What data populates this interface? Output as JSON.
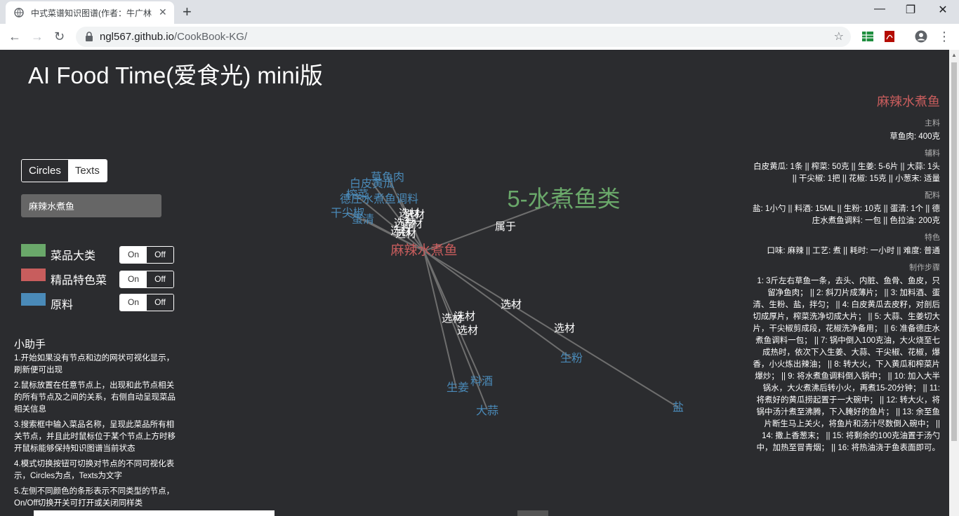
{
  "browser": {
    "tab_title": "中式菜谱知识图谱(作者：牛广林",
    "tab_close": "✕",
    "new_tab": "+",
    "url_host": "ngl567.github.io",
    "url_path": "/CookBook-KG/",
    "window_minimize": "—",
    "window_restore": "❐",
    "window_close": "✕"
  },
  "app": {
    "title": "AI Food Time(爱食光) mini版",
    "modes": {
      "circles": "Circles",
      "texts": "Texts",
      "active": "Circles"
    },
    "search_value": "麻辣水煮鱼",
    "legend": [
      {
        "label": "菜品大类",
        "color": "#6aa86a",
        "on": "On",
        "off": "Off"
      },
      {
        "label": "精品特色菜",
        "color": "#c85d5d",
        "on": "On",
        "off": "Off"
      },
      {
        "label": "原料",
        "color": "#4a8ab8",
        "on": "On",
        "off": "Off"
      }
    ],
    "helper": {
      "title": "小助手",
      "tips": [
        "1.开始如果没有节点和边的网状可视化显示，刷新便可出现",
        "2.鼠标放置在任意节点上，出现和此节点相关的所有节点及之间的关系，右侧自动呈现菜品相关信息",
        "3.搜索框中输入菜品名称，呈现此菜品所有相关节点，并且此时鼠标位于某个节点上方时移开鼠标能够保持知识图谱当前状态",
        "4.模式切换按钮可切换对节点的不同可视化表示，Circles为点，Texts为文字",
        "5.左侧不同颜色的条形表示不同类型的节点，On/Off切换开关可打开或关闭同样类"
      ]
    }
  },
  "graph": {
    "center": {
      "label": "麻辣水煮鱼"
    },
    "category": {
      "label": "5-水煮鱼类",
      "relation": "属于"
    },
    "ingredients": [
      "草鱼肉",
      "白皮黄瓜",
      "榨菜",
      "德庄水煮鱼调料",
      "干尖椒",
      "蛋清",
      "生姜",
      "料酒",
      "大蒜",
      "生粉",
      "盐"
    ],
    "relation_label": "选材"
  },
  "panel": {
    "name": "麻辣水煮鱼",
    "sections": [
      {
        "heading": "主料",
        "text": "草鱼肉: 400克"
      },
      {
        "heading": "辅料",
        "text": "白皮黄瓜: 1条 || 榨菜: 50克 || 生姜: 5-6片 || 大蒜: 1头 || 干尖椒: 1把 || 花椒: 15克 || 小葱末: 适量"
      },
      {
        "heading": "配料",
        "text": "盐: 1小勺 || 料酒: 15ML || 生粉: 10克 || 蛋清: 1个 || 德庄水煮鱼调料: 一包 || 色拉油: 200克"
      },
      {
        "heading": "特色",
        "text": "口味: 麻辣 || 工艺: 煮 || 耗时: 一小时 || 难度: 普通"
      },
      {
        "heading": "制作步骤",
        "text": "1: 3斤左右草鱼一条，去头、内脏、鱼骨、鱼皮，只留净鱼肉； || 2: 斜刀片成薄片； || 3: 加料酒、蛋清、生粉、盐，拌匀； || 4: 白皮黄瓜去皮籽，对剖后切成厚片，榨菜洗净切成大片； || 5: 大蒜、生姜切大片，干尖椒剪成段，花椒洗净备用； || 6: 准备德庄水煮鱼调料一包； || 7: 锅中倒入100克油，大火烧至七成热时，依次下入生姜、大蒜、干尖椒、花椒，爆香，小火炼出辣油； || 8: 转大火，下入黄瓜和榨菜片爆炒； || 9: 将水煮鱼调料倒入锅中； || 10: 加入大半锅水，大火煮沸后转小火，再煮15-20分钟； || 11: 将煮好的黄瓜捞起置于一大碗中； || 12: 转大火，将锅中汤汁煮至沸腾，下入腌好的鱼片； || 13: 余至鱼片断生马上关火，将鱼片和汤汁尽数倒入碗中； || 14: 撒上香葱末； || 15: 将剩余的100克油置于汤勺中，加热至冒青烟； || 16: 将热油浇于鱼表面即可。"
      }
    ]
  },
  "colors": {
    "dish_category": "#6aa86a",
    "special_dish": "#c85d5d",
    "ingredient": "#4a8ab8",
    "background": "#2b2c2f"
  }
}
